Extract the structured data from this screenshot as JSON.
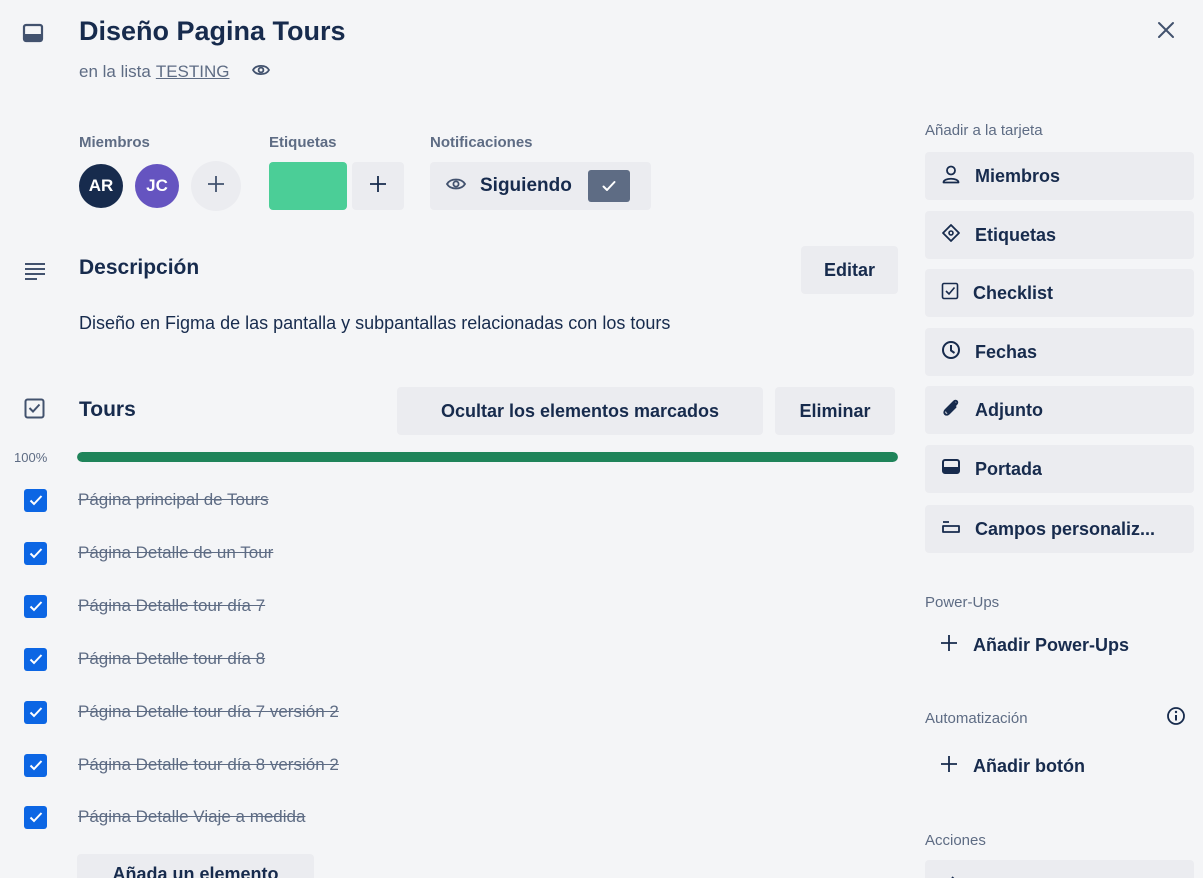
{
  "card": {
    "title": "Diseño Pagina Tours",
    "list_prefix": "en la lista",
    "list_name": "TESTING"
  },
  "members": {
    "label": "Miembros",
    "avatars": [
      "AR",
      "JC"
    ]
  },
  "labels": {
    "label": "Etiquetas",
    "color": "#4bce97"
  },
  "notifications": {
    "label": "Notificaciones",
    "button_label": "Siguiendo"
  },
  "description": {
    "title": "Descripción",
    "edit_label": "Editar",
    "text": "Diseño en Figma de las pantalla y subpantallas relacionadas con los tours"
  },
  "checklist": {
    "title": "Tours",
    "hide_checked_label": "Ocultar los elementos marcados",
    "delete_label": "Eliminar",
    "progress_text": "100%",
    "progress": 1.0,
    "progress_color": "#1f845a",
    "items": [
      {
        "text": "Página principal de Tours",
        "checked": true
      },
      {
        "text": "Página Detalle de un Tour",
        "checked": true
      },
      {
        "text": "Página Detalle tour día 7",
        "checked": true
      },
      {
        "text": "Página Detalle tour día 8",
        "checked": true
      },
      {
        "text": "Página Detalle tour día 7 versión 2",
        "checked": true
      },
      {
        "text": "Página Detalle tour día 8 versión 2",
        "checked": true
      },
      {
        "text": "Página Detalle Viaje a medida",
        "checked": true
      }
    ],
    "add_item_label": "Añada un elemento"
  },
  "sidebar": {
    "add_to_card_label": "Añadir a la tarjeta",
    "buttons": [
      {
        "label": "Miembros",
        "icon": "person-icon"
      },
      {
        "label": "Etiquetas",
        "icon": "tag-icon"
      },
      {
        "label": "Checklist",
        "icon": "checklist-icon"
      },
      {
        "label": "Fechas",
        "icon": "clock-icon"
      },
      {
        "label": "Adjunto",
        "icon": "paperclip-icon"
      },
      {
        "label": "Portada",
        "icon": "cover-icon"
      },
      {
        "label": "Campos personaliz...",
        "icon": "custom-fields-icon"
      }
    ],
    "powerups_label": "Power-Ups",
    "add_powerups_label": "Añadir Power-Ups",
    "automation_label": "Automatización",
    "add_button_label": "Añadir botón",
    "actions_label": "Acciones"
  }
}
